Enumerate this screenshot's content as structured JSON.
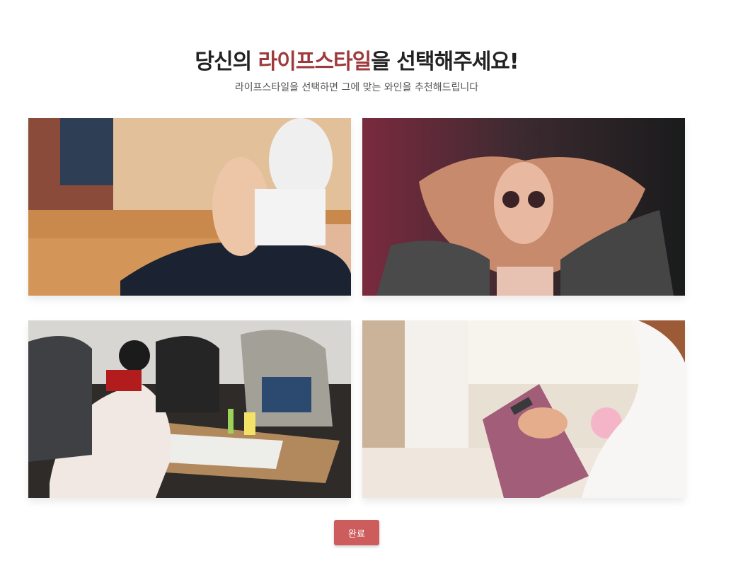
{
  "header": {
    "title_prefix": "당신의 ",
    "title_accent": "라이프스타일",
    "title_suffix": "을 선택해주세요!",
    "subtitle": "라이프스타일을 선택하면 그에 맞는 와인을 추천해드립니다"
  },
  "lifestyles": [
    {
      "icon": "yoga-photo"
    },
    {
      "icon": "woman-sunglasses-photo"
    },
    {
      "icon": "group-study-photo"
    },
    {
      "icon": "clipboard-writing-photo"
    }
  ],
  "footer": {
    "done_label": "완료"
  },
  "colors": {
    "accent": "#9e3a3c",
    "button": "#cd5c5c"
  }
}
